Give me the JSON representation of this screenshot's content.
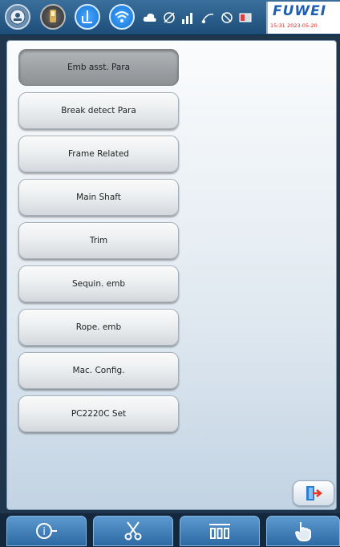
{
  "status_bar": {
    "brand_name": "FUWEI",
    "time": "15:31",
    "date": "2023-05-20",
    "icons": [
      "logo-icon",
      "light-icon",
      "needle-icon",
      "wifi-icon",
      "cloud-icon",
      "sensor-off-icon",
      "signal-icon",
      "thread-icon",
      "no-network-icon",
      "battery-icon"
    ]
  },
  "menu": {
    "items": [
      {
        "label": "Emb asst. Para",
        "active": true
      },
      {
        "label": "Break detect Para",
        "active": false
      },
      {
        "label": "Frame Related",
        "active": false
      },
      {
        "label": "Main Shaft",
        "active": false
      },
      {
        "label": "Trim",
        "active": false
      },
      {
        "label": "Sequin. emb",
        "active": false
      },
      {
        "label": "Rope. emb",
        "active": false
      },
      {
        "label": "Mac. Config.",
        "active": false
      },
      {
        "label": "PC2220C Set",
        "active": false
      }
    ]
  },
  "bottom_bar": {
    "icons": [
      "info-icon",
      "scissors-icon",
      "frame-icon",
      "hand-icon"
    ]
  },
  "colors": {
    "accent_blue": "#1573d6",
    "brand_blue": "#1e5fb0",
    "toolbar_blue": "#2d6aa3",
    "active_button": "#9ea2a5"
  }
}
